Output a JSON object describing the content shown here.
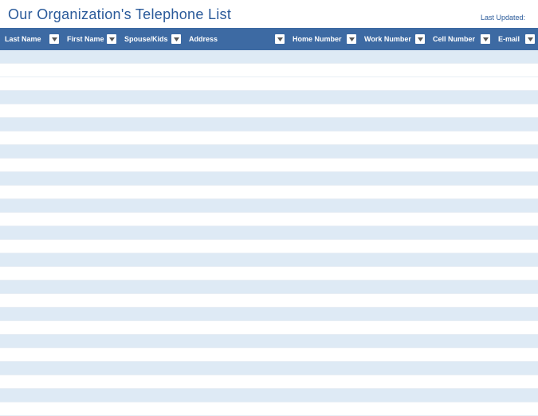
{
  "header": {
    "title": "Our Organization's Telephone List",
    "last_updated_label": "Last Updated:"
  },
  "columns": [
    {
      "label": "Last Name"
    },
    {
      "label": "First Name"
    },
    {
      "label": "Spouse/Kids"
    },
    {
      "label": "Address"
    },
    {
      "label": "Home Number"
    },
    {
      "label": "Work Number"
    },
    {
      "label": "Cell Number"
    },
    {
      "label": "E-mail"
    }
  ],
  "rows": [
    {
      "band": "light"
    },
    {
      "band": "white"
    },
    {
      "band": "white"
    },
    {
      "band": "light"
    },
    {
      "band": "white"
    },
    {
      "band": "light"
    },
    {
      "band": "white"
    },
    {
      "band": "light"
    },
    {
      "band": "white"
    },
    {
      "band": "light"
    },
    {
      "band": "white"
    },
    {
      "band": "light"
    },
    {
      "band": "white"
    },
    {
      "band": "light"
    },
    {
      "band": "white"
    },
    {
      "band": "light"
    },
    {
      "band": "white"
    },
    {
      "band": "light"
    },
    {
      "band": "white"
    },
    {
      "band": "light"
    },
    {
      "band": "white"
    },
    {
      "band": "light"
    },
    {
      "band": "white"
    },
    {
      "band": "light"
    },
    {
      "band": "white"
    },
    {
      "band": "light"
    },
    {
      "band": "white"
    }
  ]
}
